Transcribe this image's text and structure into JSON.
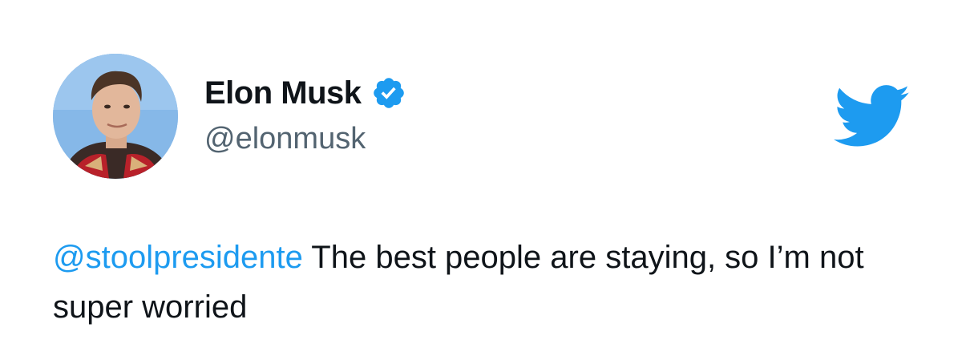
{
  "author": {
    "display_name": "Elon Musk",
    "handle": "@elonmusk",
    "verified": true,
    "avatar_icon": "profile-photo"
  },
  "tweet": {
    "mention": "@stoolpresidente",
    "text": " The best people are staying, so I’m not super worried"
  },
  "icons": {
    "verified": "verified-badge-icon",
    "brand": "twitter-bird-icon"
  },
  "colors": {
    "accent": "#1d9bf0",
    "text": "#0f1419",
    "secondary_text": "#536471"
  }
}
